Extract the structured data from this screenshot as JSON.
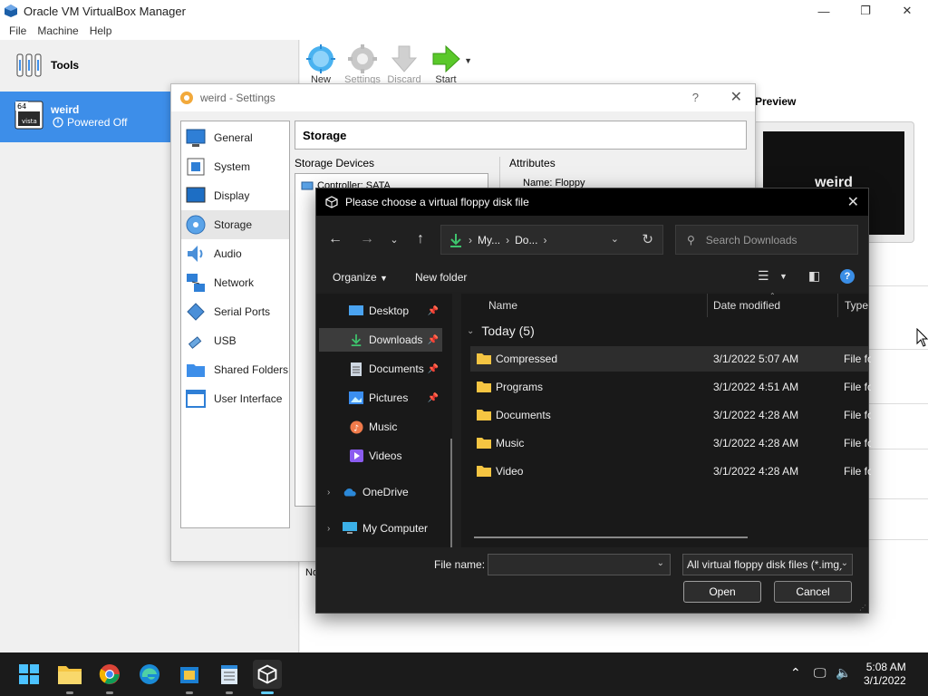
{
  "window": {
    "title": "Oracle VM VirtualBox Manager",
    "minimize": "—",
    "maximize": "❐",
    "close": "✕"
  },
  "menu": [
    "File",
    "Machine",
    "Help"
  ],
  "toolbar": {
    "new": "New",
    "settings": "Settings",
    "discard": "Discard",
    "start": "Start"
  },
  "tools": {
    "label": "Tools"
  },
  "vm": {
    "name": "weird",
    "state": "Powered Off",
    "icon_badge": "64",
    "os_label": "vista"
  },
  "preview": {
    "label": "Preview",
    "screen_text": "weird"
  },
  "right_panel": {
    "footer_text": "No"
  },
  "settings": {
    "title": "weird - Settings",
    "help": "?",
    "close": "✕",
    "nav": [
      {
        "label": "General",
        "icon": "general-icon"
      },
      {
        "label": "System",
        "icon": "system-icon"
      },
      {
        "label": "Display",
        "icon": "display-icon"
      },
      {
        "label": "Storage",
        "icon": "storage-icon"
      },
      {
        "label": "Audio",
        "icon": "audio-icon"
      },
      {
        "label": "Network",
        "icon": "network-icon"
      },
      {
        "label": "Serial Ports",
        "icon": "serial-ports-icon"
      },
      {
        "label": "USB",
        "icon": "usb-icon"
      },
      {
        "label": "Shared Folders",
        "icon": "shared-folders-icon"
      },
      {
        "label": "User Interface",
        "icon": "user-interface-icon"
      }
    ],
    "active": "Storage",
    "header": "Storage",
    "storage_devices_label": "Storage Devices",
    "attributes_label": "Attributes",
    "controller": "Controller: SATA",
    "attr_name": "Name:  Floppy"
  },
  "file_dialog": {
    "title": "Please choose a virtual floppy disk file",
    "close": "✕",
    "path": [
      "My...",
      "Do..."
    ],
    "search_placeholder": "Search Downloads",
    "organize": "Organize",
    "new_folder": "New folder",
    "sidebar": [
      {
        "label": "Desktop",
        "pinned": true
      },
      {
        "label": "Downloads",
        "pinned": true,
        "active": true
      },
      {
        "label": "Documents",
        "pinned": true
      },
      {
        "label": "Pictures",
        "pinned": true
      },
      {
        "label": "Music",
        "pinned": false
      },
      {
        "label": "Videos",
        "pinned": false
      },
      {
        "label": "OneDrive",
        "pinned": false
      },
      {
        "label": "My Computer",
        "pinned": false
      }
    ],
    "columns": {
      "name": "Name",
      "date": "Date modified",
      "type": "Type"
    },
    "group": "Today (5)",
    "files": [
      {
        "name": "Compressed",
        "date": "3/1/2022 5:07 AM",
        "type": "File folder"
      },
      {
        "name": "Programs",
        "date": "3/1/2022 4:51 AM",
        "type": "File folder"
      },
      {
        "name": "Documents",
        "date": "3/1/2022 4:28 AM",
        "type": "File folder"
      },
      {
        "name": "Music",
        "date": "3/1/2022 4:28 AM",
        "type": "File folder"
      },
      {
        "name": "Video",
        "date": "3/1/2022 4:28 AM",
        "type": "File folder"
      }
    ],
    "file_name_label": "File name:",
    "file_name_value": "",
    "filter": "All virtual floppy disk files (*.img)",
    "open": "Open",
    "cancel": "Cancel"
  },
  "taskbar": {
    "apps": [
      "start-icon",
      "file-explorer-icon",
      "chrome-icon",
      "edge-icon",
      "virtualbox-installer-icon",
      "notepad-icon",
      "virtualbox-icon"
    ],
    "time": "5:08 AM",
    "date": "3/1/2022"
  },
  "colors": {
    "accent": "#3d8ee9",
    "dark_bg": "#1f1f1f",
    "folder": "#f5c542",
    "taskbar": "#1b1b1b"
  }
}
